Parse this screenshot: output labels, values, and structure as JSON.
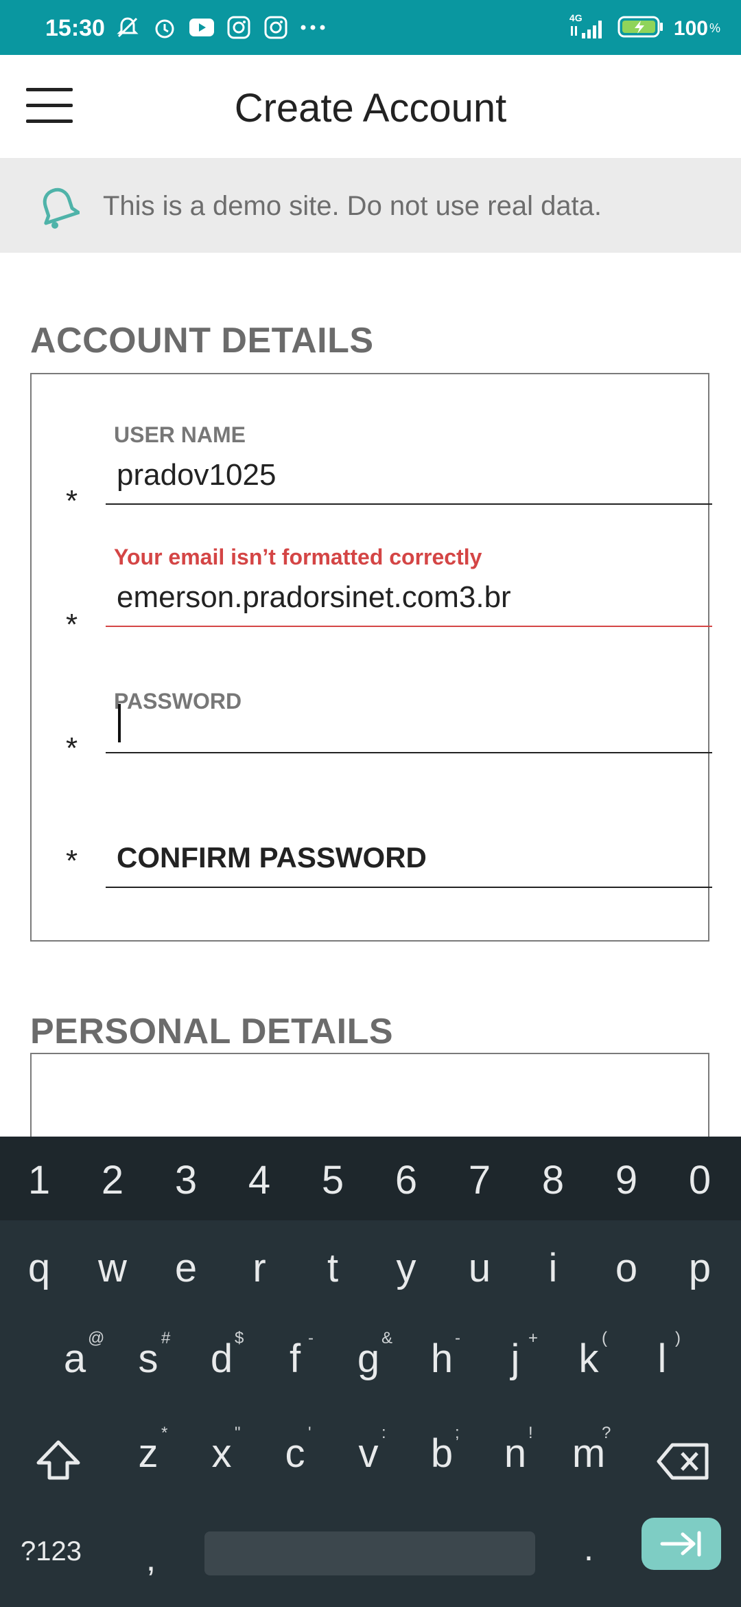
{
  "status_bar": {
    "time": "15:30",
    "icons": [
      "mute-icon",
      "alarm-icon",
      "youtube-icon",
      "instagram-icon",
      "instagram-icon",
      "more-dots-icon"
    ],
    "network": "4G",
    "battery": "100",
    "battery_unit": "%"
  },
  "app_bar": {
    "title": "Create Account",
    "menu_icon": "hamburger-menu-icon"
  },
  "banner": {
    "icon": "bell-icon",
    "text": "This is a demo site. Do not use real data."
  },
  "account_details": {
    "title": "ACCOUNT DETAILS",
    "required_mark": "*",
    "fields": {
      "username": {
        "label": "USER NAME",
        "value": "pradov1025"
      },
      "email": {
        "error": "Your email isn’t formatted correctly",
        "value": "emerson.pradorsinet.com3.br"
      },
      "password": {
        "label": "PASSWORD",
        "value": ""
      },
      "confirm_password": {
        "placeholder": "CONFIRM PASSWORD",
        "value": ""
      }
    }
  },
  "personal_details": {
    "title": "PERSONAL DETAILS"
  },
  "keyboard": {
    "numbers": [
      "1",
      "2",
      "3",
      "4",
      "5",
      "6",
      "7",
      "8",
      "9",
      "0"
    ],
    "row1": [
      "q",
      "w",
      "e",
      "r",
      "t",
      "y",
      "u",
      "i",
      "o",
      "p"
    ],
    "row2": [
      {
        "key": "a",
        "alt": "@"
      },
      {
        "key": "s",
        "alt": "#"
      },
      {
        "key": "d",
        "alt": "$"
      },
      {
        "key": "f",
        "alt": "-"
      },
      {
        "key": "g",
        "alt": "&"
      },
      {
        "key": "h",
        "alt": "-"
      },
      {
        "key": "j",
        "alt": "+"
      },
      {
        "key": "k",
        "alt": "("
      },
      {
        "key": "l",
        "alt": ")"
      }
    ],
    "row3": [
      {
        "key": "z",
        "alt": "*"
      },
      {
        "key": "x",
        "alt": "\""
      },
      {
        "key": "c",
        "alt": "'"
      },
      {
        "key": "v",
        "alt": ":"
      },
      {
        "key": "b",
        "alt": ";"
      },
      {
        "key": "n",
        "alt": "!"
      },
      {
        "key": "m",
        "alt": "?"
      }
    ],
    "symbols_key": "?123",
    "comma_key": ",",
    "period_key": ".",
    "shift_icon": "shift-icon",
    "backspace_icon": "backspace-icon",
    "enter_icon": "tab-next-icon",
    "colors": {
      "background": "#263238",
      "number_row": "#1e272c",
      "enter": "#7ecdc4"
    }
  },
  "colors": {
    "status_bar": "#0a97a0",
    "error": "#d44545",
    "banner_bg": "#ebebeb",
    "bell": "#4fb3a9"
  }
}
